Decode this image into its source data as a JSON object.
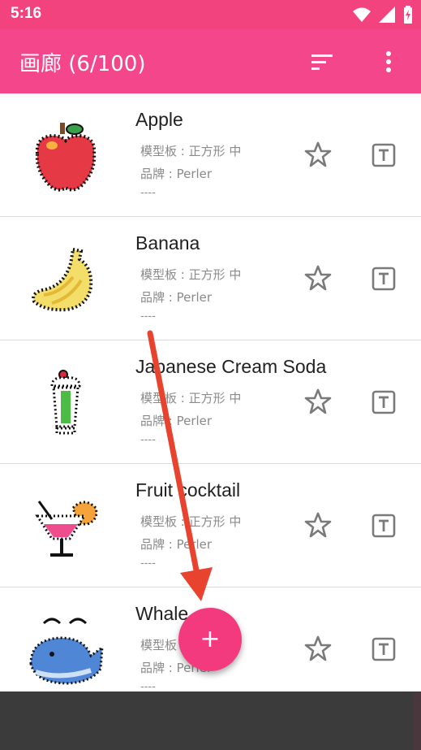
{
  "status_bar": {
    "time": "5:16",
    "icons": [
      "wifi-icon",
      "signal-icon",
      "battery-charging-icon"
    ]
  },
  "app_bar": {
    "title": "画廊 (6/100)",
    "actions": [
      "sort-icon",
      "more-vert-icon"
    ]
  },
  "patterns": [
    {
      "name": "Apple",
      "template": "模型板 : 正方形 中",
      "brand": "品牌 : Perler",
      "note": "----"
    },
    {
      "name": "Banana",
      "template": "模型板 : 正方形 中",
      "brand": "品牌 : Perler",
      "note": "----"
    },
    {
      "name": "Japanese Cream Soda",
      "template": "模型板 : 正方形 中",
      "brand": "品牌 : Perler",
      "note": "----"
    },
    {
      "name": "Fruit cocktail",
      "template": "模型板 : 正方形 中",
      "brand": "品牌 : Perler",
      "note": "----"
    },
    {
      "name": "Whale",
      "template": "模型板 : 正方形 中",
      "brand": "品牌 : Perler",
      "note": "----"
    }
  ],
  "fab": {
    "label": "+"
  },
  "colors": {
    "primary": "#f4478b",
    "status_bar": "#f2437f",
    "fab": "#f43a7f",
    "annotation_arrow": "#e8432e"
  }
}
